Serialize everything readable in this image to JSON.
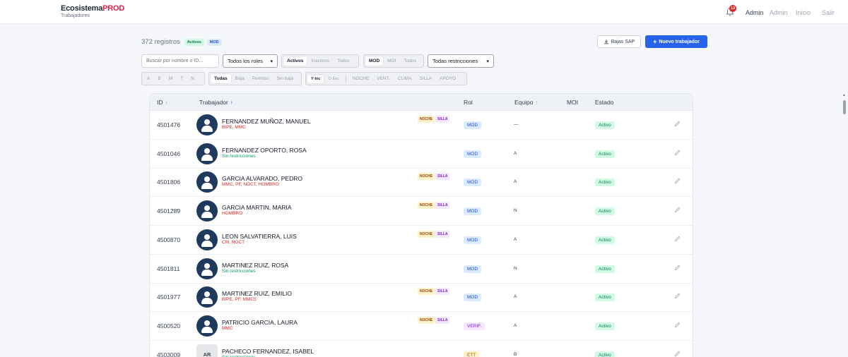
{
  "header": {
    "brand_main": "Ecosistema",
    "brand_accent": "PROD",
    "brand_sub": "Trabajadores",
    "notifications": "13",
    "user_label": "Admin",
    "role_link": "Admin",
    "home_link": "Inicio",
    "logout_link": "Salir"
  },
  "summary": {
    "count": "372 registros",
    "badge_status": "Activos",
    "badge_type": "MOD"
  },
  "actions": {
    "bajas_sap": "Bajas SAP",
    "new_worker": "Nuevo trabajador"
  },
  "filters": {
    "search_placeholder": "Buscar por nombre o ID...",
    "roles_select": "Todos los roles",
    "status_options": [
      "Activos",
      "Inactivos",
      "Todos"
    ],
    "type_options": [
      "MOD",
      "MOI",
      "Todos"
    ],
    "restrictions_select": "Todas restricciones",
    "team_options": [
      "A",
      "B",
      "M",
      "T",
      "N"
    ],
    "baja_options": [
      "Todas",
      "Baja",
      "Permiso",
      "Sin baja"
    ],
    "logic_options": [
      "Y·Inc",
      "O·Exc"
    ],
    "flag_options": [
      "NOCHE",
      "VENT.",
      "CLIMA",
      "SILLA",
      "APOYO"
    ]
  },
  "table": {
    "headers": {
      "id": "ID",
      "worker": "Trabajador",
      "role": "Rol",
      "team": "Equipo",
      "moi": "MOI",
      "status": "Estado"
    },
    "rows": [
      {
        "id": "4501476",
        "name": "FERNANDEZ MUÑOZ, MANUEL",
        "restrictions": "BIPE, MMC",
        "noche": "NOCHE",
        "silla": "SILLA",
        "role": "MOD",
        "team": "—",
        "status": "Activo"
      },
      {
        "id": "4501046",
        "name": "FERNANDEZ OPORTO, ROSA",
        "restrictions": "Sin restricciones",
        "noche": "",
        "silla": "",
        "role": "MOD",
        "team": "A",
        "status": "Activo"
      },
      {
        "id": "4501806",
        "name": "GARCIA ALVARADO, PEDRO",
        "restrictions": "MMC, PF, NOCT, HOMBRO",
        "noche": "NOCHE",
        "silla": "SILLA",
        "role": "MOD",
        "team": "A",
        "status": "Activo"
      },
      {
        "id": "4501289",
        "name": "GARCIA MARTIN, MARIA",
        "restrictions": "HOMBRO",
        "noche": "NOCHE",
        "silla": "SILLA",
        "role": "MOD",
        "team": "N",
        "status": "Activo"
      },
      {
        "id": "4500870",
        "name": "LEON SALVATIERRA, LUIS",
        "restrictions": "CM, NOCT",
        "noche": "NOCHE",
        "silla": "SILLA",
        "role": "MOD",
        "team": "A",
        "status": "Activo"
      },
      {
        "id": "4501811",
        "name": "MARTINEZ RUIZ, ROSA",
        "restrictions": "Sin restricciones",
        "noche": "",
        "silla": "",
        "role": "MOD",
        "team": "N",
        "status": "Activo"
      },
      {
        "id": "4501977",
        "name": "MARTINEZ RUIZ, EMILIO",
        "restrictions": "BIPE, PF, MMC5",
        "noche": "NOCHE",
        "silla": "SILLA",
        "role": "MOD",
        "team": "A",
        "status": "Activo"
      },
      {
        "id": "4500520",
        "name": "PATRICIO GARCIA, LAURA",
        "restrictions": "MMC",
        "noche": "NOCHE",
        "silla": "SILLA",
        "role": "VERIF.",
        "team": "A",
        "status": "Activo"
      },
      {
        "id": "4503009",
        "name": "PACHECO FERNANDEZ, ISABEL",
        "restrictions": "Sin restricciones",
        "noche": "",
        "silla": "",
        "role": "ETT",
        "team": "B",
        "status": "Activo",
        "initials": "AR"
      }
    ]
  },
  "colors": {
    "primary": "#2563eb",
    "active_green": "#047857",
    "restriction_red": "#dc2626",
    "avatar": "#1e3a5f"
  }
}
